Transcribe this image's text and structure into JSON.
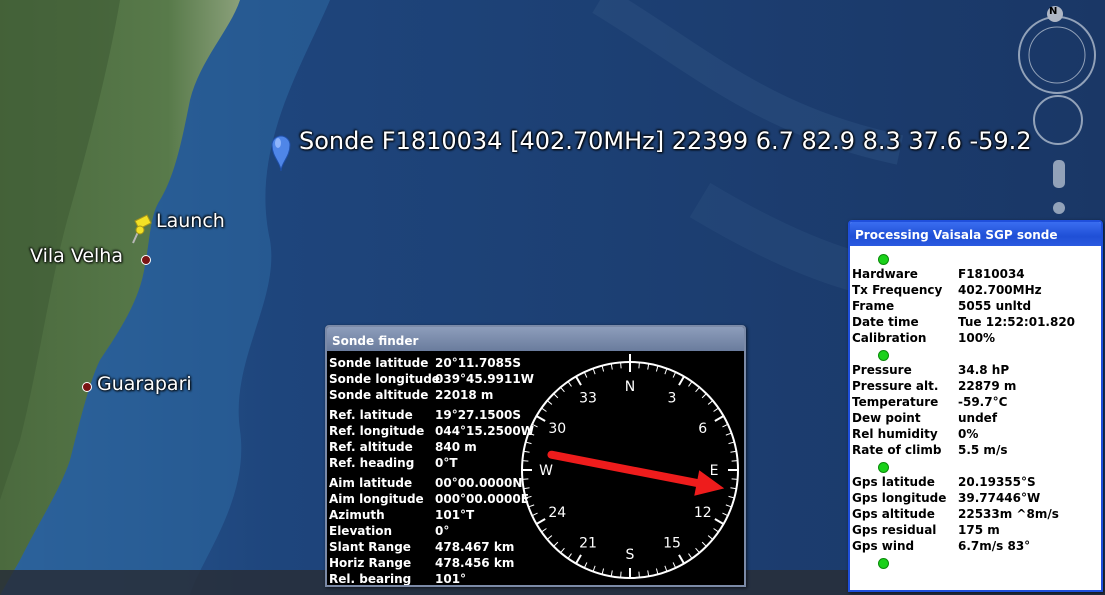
{
  "map": {
    "sonde_label": "Sonde F1810034 [402.70MHz] 22399 6.7 82.9 8.3 37.6 -59.2",
    "launch_label": "Launch",
    "places": [
      "Vila Velha",
      "Guarapari"
    ]
  },
  "navigation": {
    "north_label": "N"
  },
  "sonde_finder": {
    "title": "Sonde finder",
    "rows": [
      {
        "k": "Sonde latitude",
        "v": "20°11.7085S"
      },
      {
        "k": "Sonde longitude",
        "v": "039°45.9911W"
      },
      {
        "k": "Sonde altitude",
        "v": "22018 m"
      },
      {
        "k": "Ref. latitude",
        "v": "19°27.1500S"
      },
      {
        "k": "Ref. longitude",
        "v": "044°15.2500W"
      },
      {
        "k": "Ref. altitude",
        "v": "840 m"
      },
      {
        "k": "Ref. heading",
        "v": "0°T"
      },
      {
        "k": "Aim latitude",
        "v": "00°00.0000N"
      },
      {
        "k": "Aim longitude",
        "v": "000°00.0000E"
      },
      {
        "k": "Azimuth",
        "v": "101°T"
      },
      {
        "k": "Elevation",
        "v": "0°"
      },
      {
        "k": "Slant Range",
        "v": "478.467 km"
      },
      {
        "k": "Horiz Range",
        "v": "478.456 km"
      },
      {
        "k": "Rel. bearing",
        "v": "101°"
      }
    ],
    "compass_labels": [
      "N",
      "3",
      "6",
      "E",
      "12",
      "15",
      "S",
      "21",
      "24",
      "W",
      "30",
      "33"
    ],
    "bearing_deg": 101,
    "colors": {
      "arrow": "#ee1c1c",
      "dial": "#ffffff",
      "background": "#000000"
    }
  },
  "vaisala": {
    "title": "Processing Vaisala SGP sonde",
    "groups": [
      [
        {
          "k": "Hardware",
          "v": "F1810034"
        },
        {
          "k": "Tx Frequency",
          "v": "402.700MHz"
        },
        {
          "k": "Frame",
          "v": "5055 unltd"
        },
        {
          "k": "Date time",
          "v": "Tue 12:52:01.820"
        },
        {
          "k": "Calibration",
          "v": "100%"
        }
      ],
      [
        {
          "k": "Pressure",
          "v": "34.8 hP"
        },
        {
          "k": "Pressure alt.",
          "v": "22879 m"
        },
        {
          "k": "Temperature",
          "v": "-59.7°C"
        },
        {
          "k": "Dew point",
          "v": "undef"
        },
        {
          "k": "Rel humidity",
          "v": "0%"
        },
        {
          "k": "Rate of climb",
          "v": "5.5 m/s"
        }
      ],
      [
        {
          "k": "Gps latitude",
          "v": "20.19355°S"
        },
        {
          "k": "Gps longitude",
          "v": "39.77446°W"
        },
        {
          "k": "Gps altitude",
          "v": "22533m ^8m/s"
        },
        {
          "k": "Gps residual",
          "v": "175 m"
        },
        {
          "k": "Gps wind",
          "v": "6.7m/s 83°"
        }
      ]
    ],
    "status_color": "#1ad11a"
  }
}
